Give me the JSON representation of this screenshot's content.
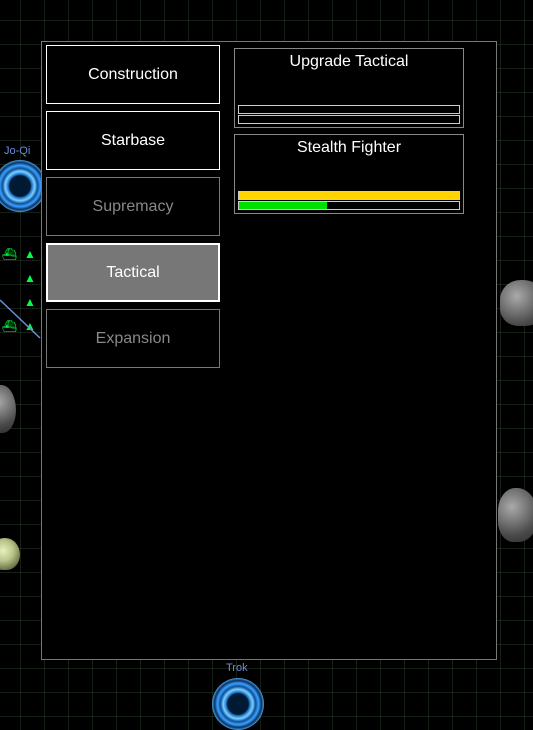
{
  "map": {
    "labels": {
      "jo_qi": "Jo-Qi",
      "trok": "Trok"
    }
  },
  "build_menu": {
    "categories": [
      {
        "label": "Construction",
        "state": "normal"
      },
      {
        "label": "Starbase",
        "state": "normal"
      },
      {
        "label": "Supremacy",
        "state": "disabled"
      },
      {
        "label": "Tactical",
        "state": "selected"
      },
      {
        "label": "Expansion",
        "state": "disabled"
      }
    ],
    "queue": [
      {
        "title": "Upgrade Tactical",
        "primary_progress": 0.0,
        "secondary_progress": 0.0
      },
      {
        "title": "Stealth Fighter",
        "primary_progress": 1.0,
        "secondary_progress": 0.4
      }
    ]
  },
  "colors": {
    "primary_bar": "#ffd400",
    "secondary_bar": "#00e000",
    "friendly_ships": "#00ff44",
    "planet_label": "#6a8fd8"
  }
}
